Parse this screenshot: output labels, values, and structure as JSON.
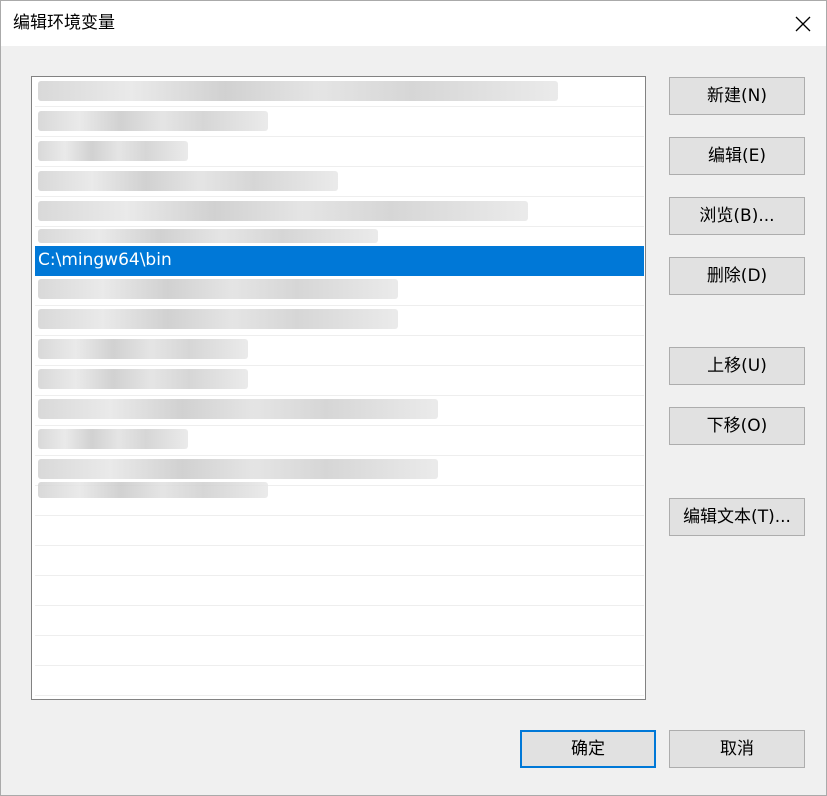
{
  "window": {
    "title": "编辑环境变量",
    "close_glyph": "✕"
  },
  "list": {
    "selected_entry": "C:\\mingw64\\bin"
  },
  "buttons": {
    "new": "新建(N)",
    "edit": "编辑(E)",
    "browse": "浏览(B)...",
    "delete": "删除(D)",
    "move_up": "上移(U)",
    "move_down": "下移(O)",
    "edit_text": "编辑文本(T)...",
    "ok": "确定",
    "cancel": "取消"
  },
  "colors": {
    "selection": "#0078d7",
    "dialog_bg": "#f0f0f0",
    "button_bg": "#e1e1e1",
    "default_button_border": "#0078d7"
  }
}
